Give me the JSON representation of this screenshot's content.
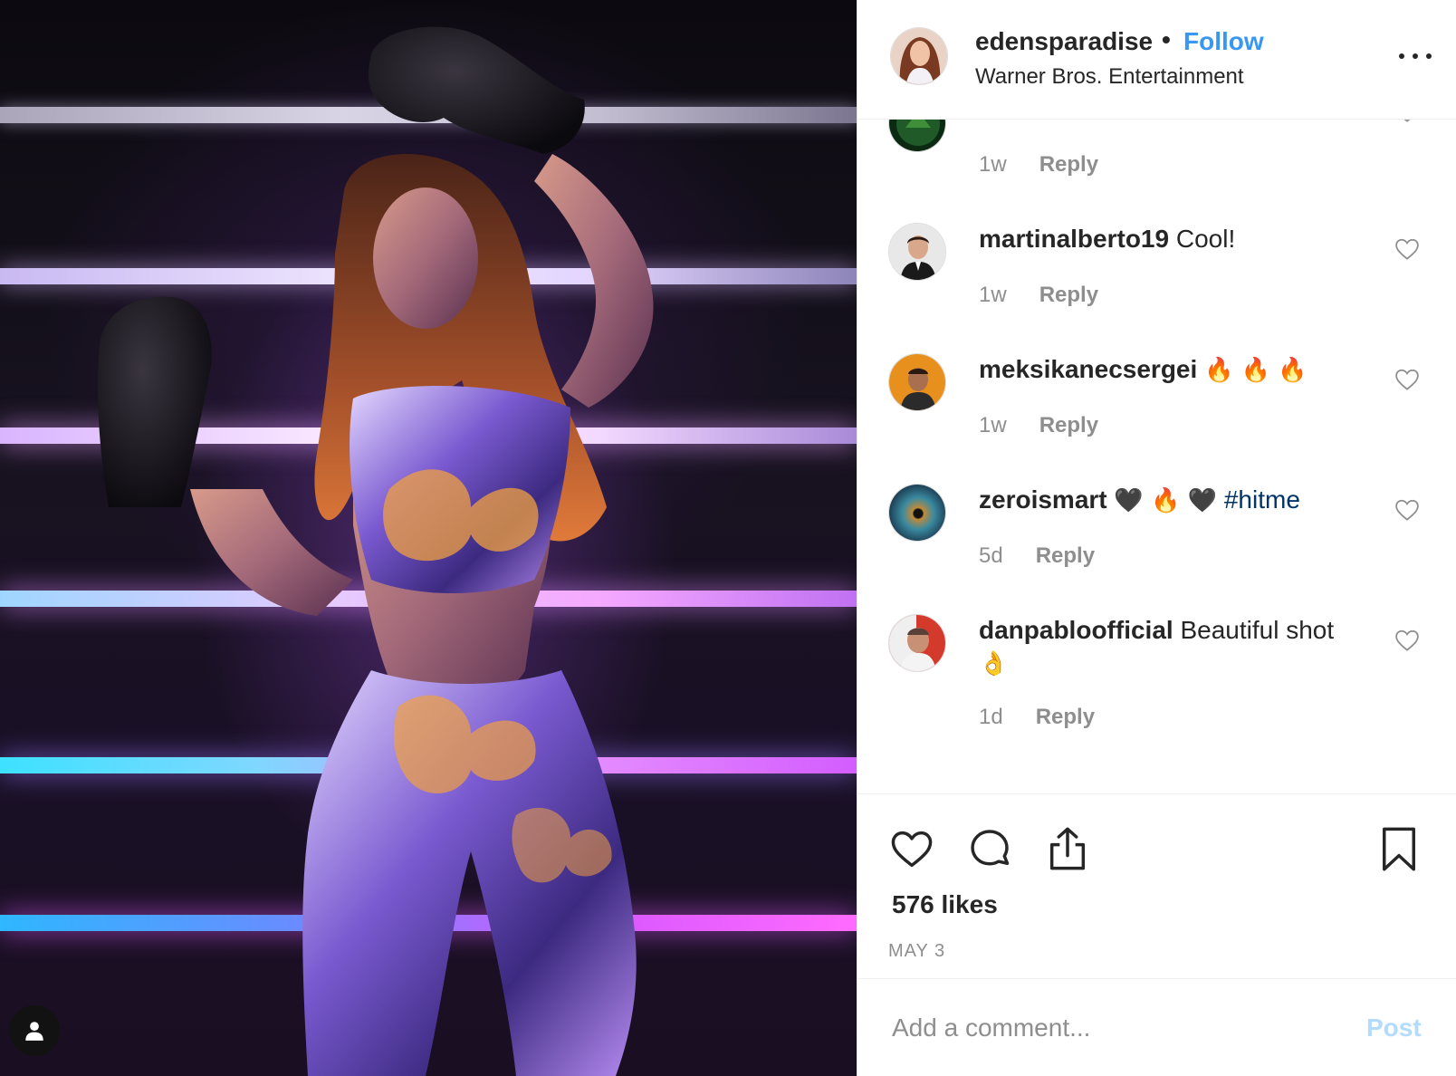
{
  "post": {
    "username": "edensparadise",
    "separator": "•",
    "follow_label": "Follow",
    "subtitle": "Warner Bros. Entertainment"
  },
  "comments": [
    {
      "time": "1w",
      "reply_label": "Reply"
    },
    {
      "username": "martinalberto19",
      "text": "Cool!",
      "time": "1w",
      "reply_label": "Reply"
    },
    {
      "username": "meksikanecsergei",
      "emoji": "🔥 🔥 🔥",
      "time": "1w",
      "reply_label": "Reply"
    },
    {
      "username": "zeroismart",
      "emoji": "🖤 🔥 🖤",
      "hashtag": "#hitme",
      "time": "5d",
      "reply_label": "Reply"
    },
    {
      "username": "danpabloofficial",
      "text": "Beautiful shot",
      "emoji": "👌",
      "time": "1d",
      "reply_label": "Reply"
    }
  ],
  "actions": {
    "likes": "576 likes",
    "date": "MAY 3"
  },
  "composer": {
    "placeholder": "Add a comment...",
    "post_label": "Post"
  },
  "colors": {
    "follow": "#3897f0",
    "hashtag": "#003569",
    "post_disabled": "#b3dbff",
    "meta": "#8e8e8e"
  },
  "icons": {
    "more": "more-options-icon",
    "like": "heart-icon",
    "comment": "comment-icon",
    "share": "share-icon",
    "save": "bookmark-icon",
    "profile": "person-icon"
  }
}
